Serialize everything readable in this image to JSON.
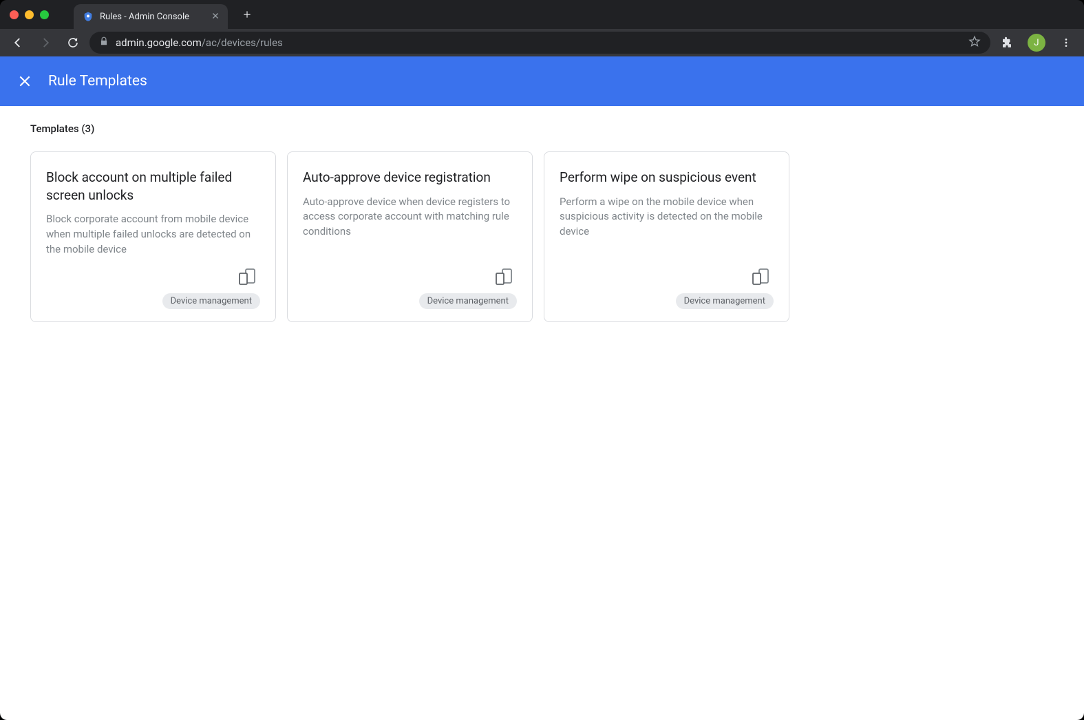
{
  "browser": {
    "tab_title": "Rules - Admin Console",
    "url_domain": "admin.google.com",
    "url_path": "/ac/devices/rules",
    "profile_initial": "J"
  },
  "page": {
    "header_title": "Rule Templates",
    "section_heading": "Templates (3)"
  },
  "templates": [
    {
      "title": "Block account on multiple failed screen unlocks",
      "description": "Block corporate account from mobile device when multiple failed unlocks are detected on the mobile device",
      "tag": "Device management"
    },
    {
      "title": "Auto-approve device registration",
      "description": "Auto-approve device when device registers to access corporate account with matching rule conditions",
      "tag": "Device management"
    },
    {
      "title": "Perform wipe on suspicious event",
      "description": "Perform a wipe on the mobile device when suspicious activity is detected on the mobile device",
      "tag": "Device management"
    }
  ]
}
